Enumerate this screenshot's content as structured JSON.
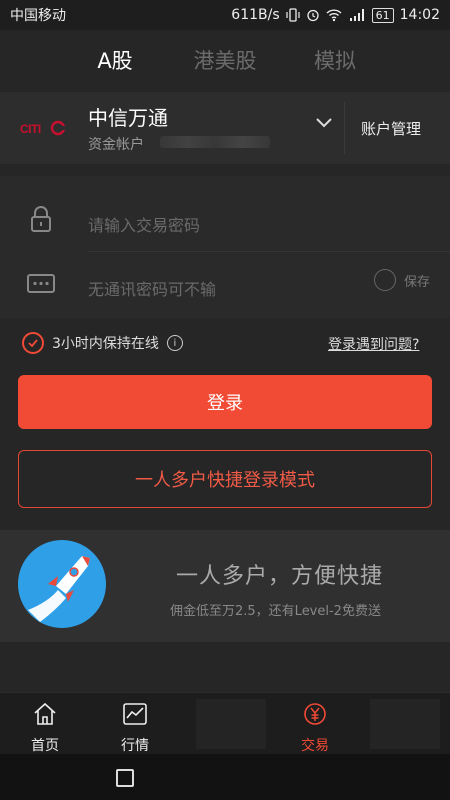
{
  "status_bar": {
    "carrier": "中国移动",
    "speed": "611B/s",
    "battery": "61",
    "time": "14:02"
  },
  "tabs": [
    {
      "label": "A股",
      "active": true
    },
    {
      "label": "港美股",
      "active": false
    },
    {
      "label": "模拟",
      "active": false
    }
  ],
  "account": {
    "logo_text": "CITIC",
    "broker_name": "中信万通",
    "fund_account_label": "资金帐户",
    "manage_label": "账户管理"
  },
  "form": {
    "password_placeholder": "请输入交易密码",
    "comm_password_placeholder": "无通讯密码可不输",
    "save_label": "保存"
  },
  "keep_online": {
    "label": "3小时内保持在线",
    "checked": true
  },
  "trouble_link": "登录遇到问题?",
  "buttons": {
    "login": "登录",
    "multi_account": "一人多户快捷登录模式"
  },
  "promo": {
    "title": "一人多户，方便快捷",
    "subtitle": "佣金低至万2.5，还有Level-2免费送"
  },
  "bottom_nav": [
    {
      "label": "首页",
      "icon": "home-icon"
    },
    {
      "label": "行情",
      "icon": "chart-icon"
    },
    {
      "label": "交易",
      "icon": "trade-icon",
      "active": true
    }
  ],
  "colors": {
    "accent": "#f14a35",
    "background": "#262626",
    "panel": "#2d2d2d"
  }
}
